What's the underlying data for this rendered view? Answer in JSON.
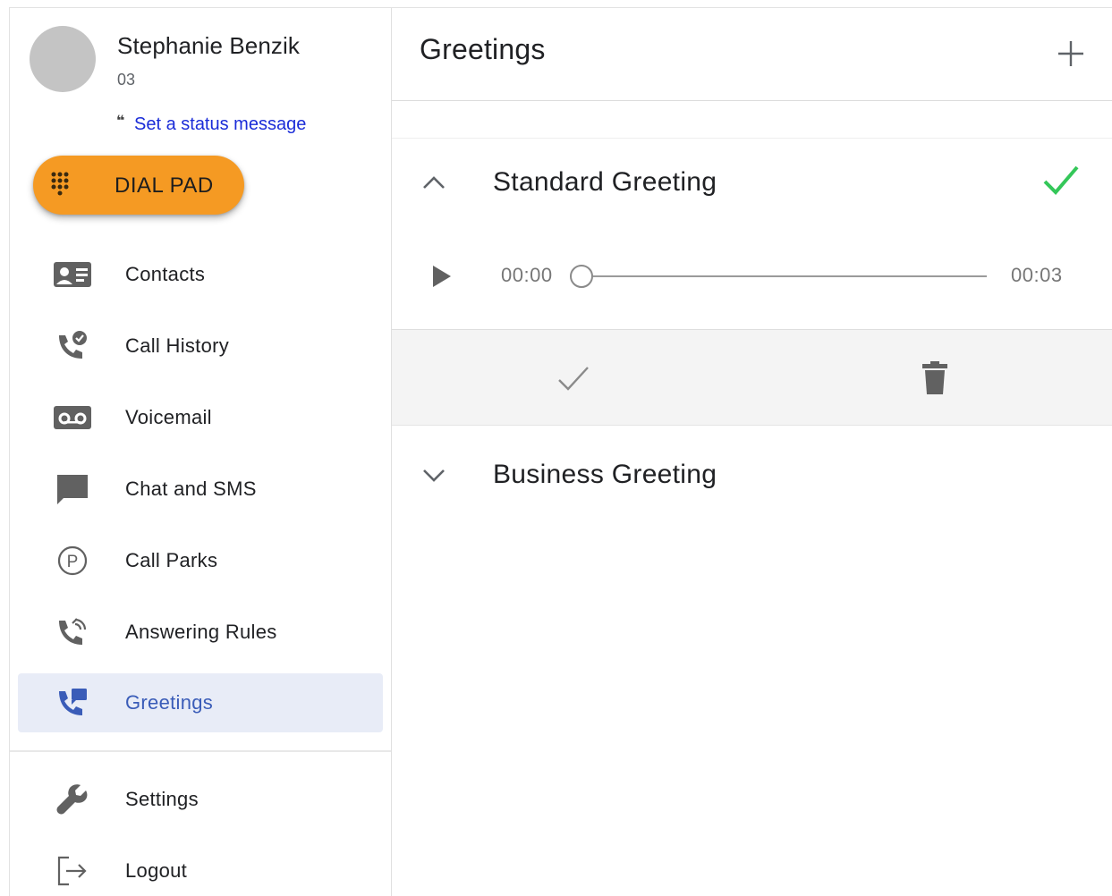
{
  "user": {
    "name": "Stephanie Benzik",
    "extension": "03",
    "status_quote": "❝",
    "status_link": "Set a status message"
  },
  "dialpad": {
    "label": "DIAL PAD",
    "icon": "dialpad-icon",
    "color": "#f59a23"
  },
  "nav": {
    "items": [
      {
        "label": "Contacts",
        "icon": "contacts-icon"
      },
      {
        "label": "Call History",
        "icon": "call-history-icon"
      },
      {
        "label": "Voicemail",
        "icon": "voicemail-icon"
      },
      {
        "label": "Chat and SMS",
        "icon": "chat-icon"
      },
      {
        "label": "Call Parks",
        "icon": "call-parks-icon"
      },
      {
        "label": "Answering Rules",
        "icon": "answering-rules-icon"
      },
      {
        "label": "Greetings",
        "icon": "greetings-icon",
        "active": true
      },
      {
        "label": "Settings",
        "icon": "wrench-icon"
      },
      {
        "label": "Logout",
        "icon": "logout-icon"
      }
    ],
    "active_color": "#3a5cb8",
    "active_bg": "#e8ecf7"
  },
  "main": {
    "title": "Greetings",
    "add_icon": "plus-icon",
    "greetings": [
      {
        "name": "Standard Greeting",
        "expanded": true,
        "default": true
      },
      {
        "name": "Business Greeting",
        "expanded": false,
        "default": false
      }
    ],
    "player": {
      "current_time": "00:00",
      "total_time": "00:03",
      "progress": 0
    },
    "check_color": "#34c759"
  }
}
